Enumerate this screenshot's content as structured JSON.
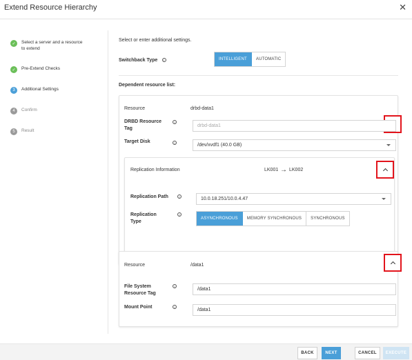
{
  "window": {
    "title": "Extend Resource Hierarchy",
    "close_glyph": "✕"
  },
  "steps": [
    {
      "label": "Select a server and a resource to extend",
      "state": "done",
      "marker": "✓"
    },
    {
      "label": "Pre-Extend Checks",
      "state": "done",
      "marker": "✓"
    },
    {
      "label": "Additional Settings",
      "state": "active",
      "marker": "3"
    },
    {
      "label": "Confirm",
      "state": "todo",
      "marker": "4"
    },
    {
      "label": "Result",
      "state": "todo",
      "marker": "5"
    }
  ],
  "main": {
    "intro": "Select or enter additional settings.",
    "switchback": {
      "label": "Switchback Type",
      "options": [
        "INTELLIGENT",
        "AUTOMATIC"
      ],
      "selected": "INTELLIGENT"
    },
    "dependent_heading": "Dependent resource list:",
    "info_glyph": "i",
    "card1": {
      "resource_label": "Resource",
      "resource_value": "drbd-data1",
      "tag_label": "DRBD Resource Tag",
      "tag_placeholder": "drbd-data1",
      "disk_label": "Target Disk",
      "disk_value": "/dev/xvdf1 (40.0 GB)",
      "replication": {
        "title": "Replication Information",
        "from": "LK001",
        "arrow": "→",
        "to": "LK002",
        "path_label": "Replication Path",
        "path_value": "10.0.18.251/10.0.4.47",
        "type_label": "Replication Type",
        "type_options": [
          "ASYNCHRONOUS",
          "MEMORY SYNCHRONOUS",
          "SYNCHRONOUS"
        ],
        "type_selected": "ASYNCHRONOUS"
      }
    },
    "card2": {
      "resource_label": "Resource",
      "resource_value": "/data1",
      "fs_tag_label": "File System Resource Tag",
      "fs_tag_value": "/data1",
      "mount_label": "Mount Point",
      "mount_value": "/data1"
    }
  },
  "footer": {
    "back": "BACK",
    "next": "NEXT",
    "cancel": "CANCEL",
    "execute": "EXECUTE"
  },
  "colors": {
    "accent": "#4a9fd8",
    "done": "#6bbf59",
    "highlight": "#e2131b"
  }
}
